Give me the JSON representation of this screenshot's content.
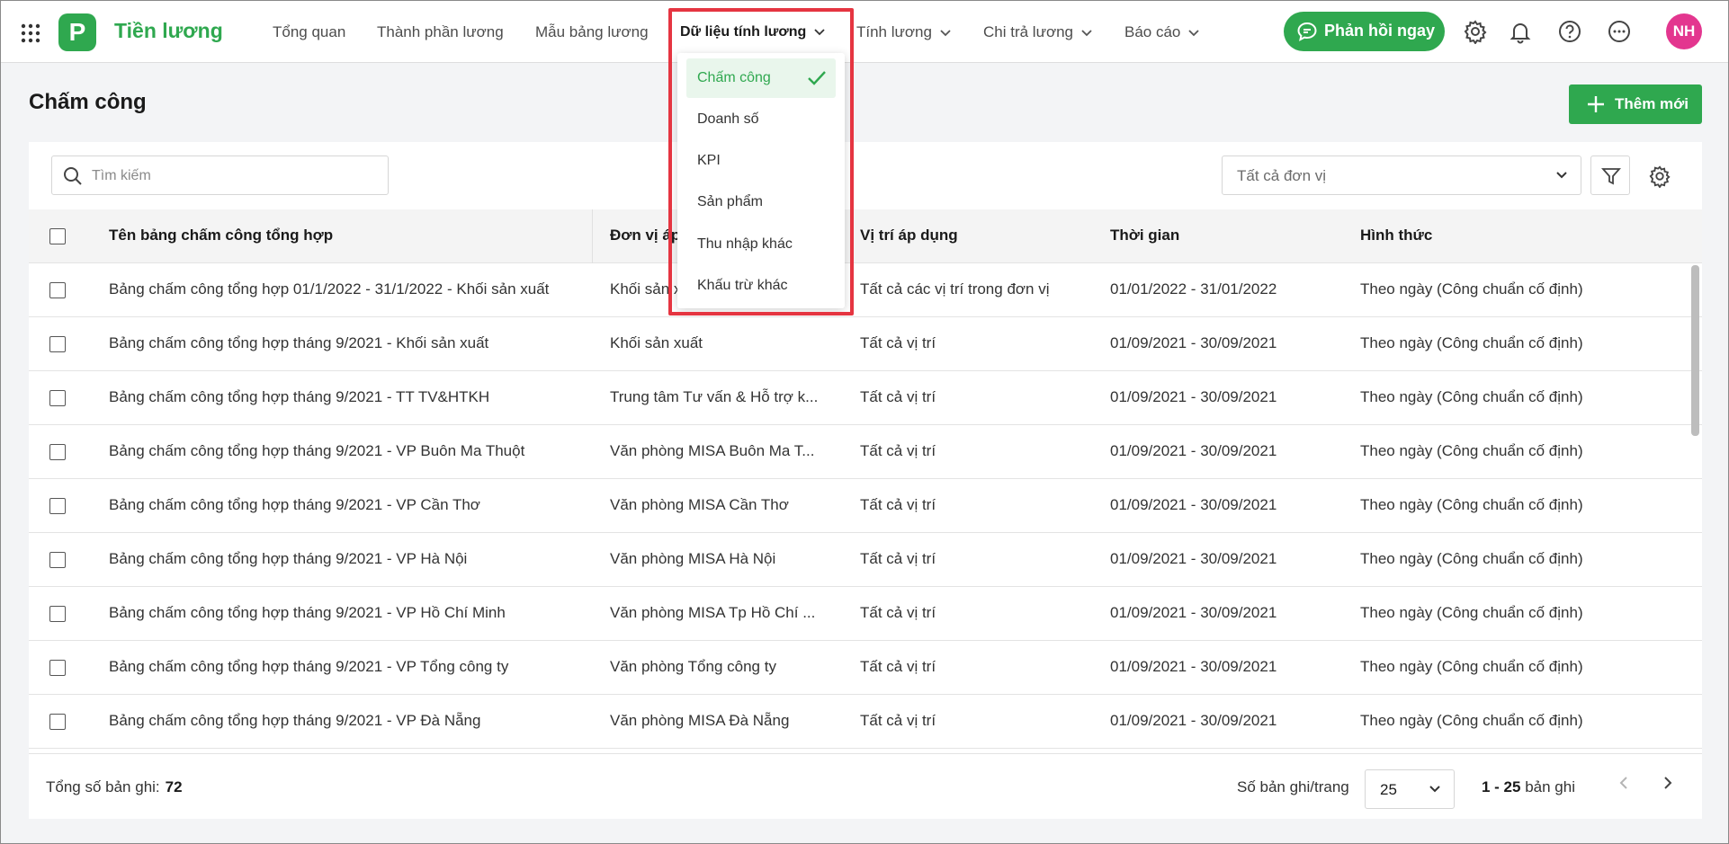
{
  "app": {
    "name": "Tiền lương",
    "logo_letter": "P",
    "brand_color": "#2fa84f"
  },
  "nav": {
    "items": [
      {
        "label": "Tổng quan"
      },
      {
        "label": "Thành phần lương"
      },
      {
        "label": "Mẫu bảng lương"
      },
      {
        "label": "Dữ liệu tính lương"
      },
      {
        "label": "Tính lương"
      },
      {
        "label": "Chi trả lương"
      },
      {
        "label": "Báo cáo"
      }
    ],
    "active": "Dữ liệu tính lương"
  },
  "header": {
    "feedback_label": "Phản hồi ngay",
    "avatar_initials": "NH",
    "avatar_color": "#e3368f",
    "icons": [
      "gear-icon",
      "bell-icon",
      "help-icon",
      "more-icon"
    ]
  },
  "dropdown": {
    "items": [
      {
        "label": "Chấm công",
        "selected": true
      },
      {
        "label": "Doanh số"
      },
      {
        "label": "KPI"
      },
      {
        "label": "Sản phẩm"
      },
      {
        "label": "Thu nhập khác"
      },
      {
        "label": "Khấu trừ khác"
      }
    ],
    "highlight_color": "#e53541"
  },
  "page": {
    "title": "Chấm công",
    "add_button_label": "Thêm mới"
  },
  "toolbar": {
    "search_placeholder": "Tìm kiếm",
    "unit_select_value": "Tất cả đơn vị"
  },
  "table": {
    "headers": [
      "Tên bảng chấm công tổng hợp",
      "Đơn vị áp dụng",
      "Vị trí áp dụng",
      "Thời gian",
      "Hình thức"
    ],
    "rows": [
      {
        "name": "Bảng chấm công tổng hợp 01/1/2022 - 31/1/2022 - Khối sản xuất",
        "unit": "Khối sản xuất",
        "position": "Tất cả các vị trí trong đơn vị",
        "time": "01/01/2022 - 31/01/2022",
        "type": "Theo ngày (Công chuẩn cố định)"
      },
      {
        "name": "Bảng chấm công tổng hợp tháng 9/2021 - Khối sản xuất",
        "unit": "Khối sản xuất",
        "position": "Tất cả vị trí",
        "time": "01/09/2021 - 30/09/2021",
        "type": "Theo ngày (Công chuẩn cố định)"
      },
      {
        "name": "Bảng chấm công tổng hợp tháng 9/2021 - TT TV&HTKH",
        "unit": "Trung tâm Tư vấn & Hỗ trợ k...",
        "position": "Tất cả vị trí",
        "time": "01/09/2021 - 30/09/2021",
        "type": "Theo ngày (Công chuẩn cố định)"
      },
      {
        "name": "Bảng chấm công tổng hợp tháng 9/2021 - VP Buôn Ma Thuột",
        "unit": "Văn phòng MISA Buôn Ma T...",
        "position": "Tất cả vị trí",
        "time": "01/09/2021 - 30/09/2021",
        "type": "Theo ngày (Công chuẩn cố định)"
      },
      {
        "name": "Bảng chấm công tổng hợp tháng 9/2021 - VP Cần Thơ",
        "unit": "Văn phòng MISA Cần Thơ",
        "position": "Tất cả vị trí",
        "time": "01/09/2021 - 30/09/2021",
        "type": "Theo ngày (Công chuẩn cố định)"
      },
      {
        "name": "Bảng chấm công tổng hợp tháng 9/2021 - VP Hà Nội",
        "unit": "Văn phòng MISA Hà Nội",
        "position": "Tất cả vị trí",
        "time": "01/09/2021 - 30/09/2021",
        "type": "Theo ngày (Công chuẩn cố định)"
      },
      {
        "name": "Bảng chấm công tổng hợp tháng 9/2021 - VP Hồ Chí Minh",
        "unit": "Văn phòng MISA Tp Hồ Chí ...",
        "position": "Tất cả vị trí",
        "time": "01/09/2021 - 30/09/2021",
        "type": "Theo ngày (Công chuẩn cố định)"
      },
      {
        "name": "Bảng chấm công tổng hợp tháng 9/2021 - VP Tổng công ty",
        "unit": "Văn phòng Tổng công ty",
        "position": "Tất cả vị trí",
        "time": "01/09/2021 - 30/09/2021",
        "type": "Theo ngày (Công chuẩn cố định)"
      },
      {
        "name": "Bảng chấm công tổng hợp tháng 9/2021 - VP Đà Nẵng",
        "unit": "Văn phòng MISA Đà Nẵng",
        "position": "Tất cả vị trí",
        "time": "01/09/2021 - 30/09/2021",
        "type": "Theo ngày (Công chuẩn cố định)"
      }
    ]
  },
  "footer": {
    "total_label": "Tổng số bản ghi:",
    "total_value": "72",
    "per_page_label": "Số bản ghi/trang",
    "per_page_value": "25",
    "range_value": "1 - 25",
    "range_suffix": "bản ghi"
  }
}
